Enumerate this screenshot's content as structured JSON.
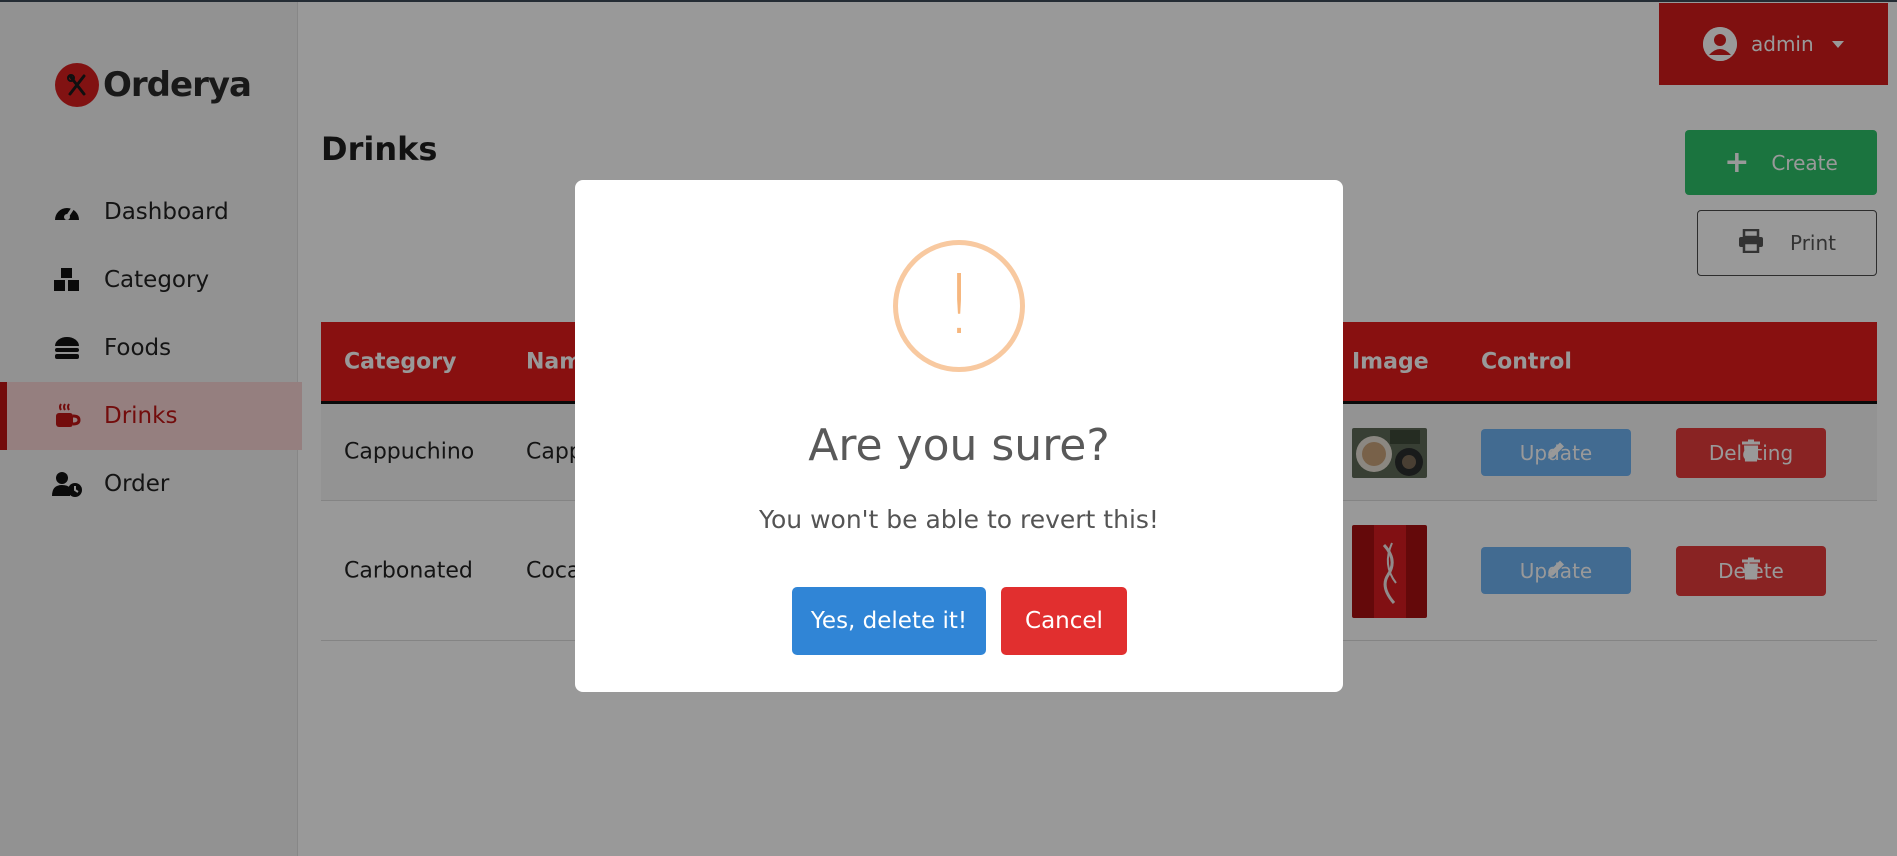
{
  "brand": {
    "name": "Orderya",
    "color": "#d81f1f"
  },
  "user": {
    "name": "admin"
  },
  "sidebar": {
    "items": [
      {
        "label": "Dashboard",
        "icon": "gauge-icon"
      },
      {
        "label": "Category",
        "icon": "boxes-icon"
      },
      {
        "label": "Foods",
        "icon": "burger-icon"
      },
      {
        "label": "Drinks",
        "icon": "mug-icon",
        "active": true
      },
      {
        "label": "Order",
        "icon": "user-clock-icon"
      }
    ]
  },
  "page": {
    "title": "Drinks",
    "create_label": "Create",
    "print_label": "Print"
  },
  "table": {
    "headers": {
      "category": "Category",
      "name": "Nam",
      "image": "Image",
      "control": "Control"
    },
    "rows": [
      {
        "category": "Cappuchino",
        "name": "Capp",
        "image": "cappuccino-thumbnail",
        "update_label": "Update",
        "delete_label": "Deleting"
      },
      {
        "category": "Carbonated",
        "name": "Coca",
        "image": "coca-cola-thumbnail",
        "update_label": "Update",
        "delete_label": "Delete"
      }
    ]
  },
  "dialog": {
    "icon": "warning-icon",
    "title": "Are you sure?",
    "text": "You won't be able to revert this!",
    "confirm_label": "Yes, delete it!",
    "cancel_label": "Cancel"
  },
  "colors": {
    "primary_red": "#d41c1c",
    "header_red": "#e31b1b",
    "create_green": "#2ec26a",
    "update_blue": "#6fb2f2",
    "confirm_blue": "#3085d6",
    "warning_orange": "#f8c9a0"
  }
}
